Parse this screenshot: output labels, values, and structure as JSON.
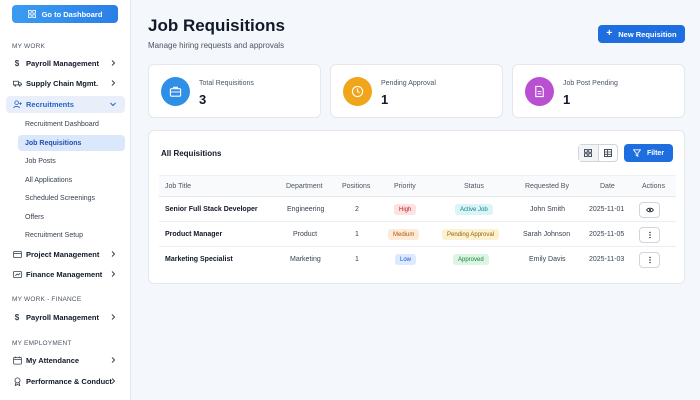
{
  "sidebar": {
    "dashboard_button": "Go to Dashboard",
    "sections": {
      "my_work": "MY WORK",
      "my_work_finance": "MY WORK - FINANCE",
      "my_employment": "MY EMPLOYMENT"
    },
    "items": {
      "payroll": {
        "label": "Payroll Management",
        "icon": "dollar-icon"
      },
      "supply_chain": {
        "label": "Supply Chain Mgmt.",
        "icon": "truck-icon"
      },
      "recruitments": {
        "label": "Recruitments",
        "icon": "user-plus-icon"
      },
      "project": {
        "label": "Project Management",
        "icon": "folder-icon"
      },
      "finance": {
        "label": "Finance Management",
        "icon": "finance-icon"
      },
      "payroll_finance": {
        "label": "Payroll Management",
        "icon": "dollar-icon"
      },
      "attendance": {
        "label": "My Attendance",
        "icon": "calendar-icon"
      },
      "performance": {
        "label": "Performance & Conduct",
        "icon": "award-icon"
      }
    },
    "recruitment_sub": [
      "Recruitment Dashboard",
      "Job Requisitions",
      "Job Posts",
      "All Applications",
      "Scheduled Screenings",
      "Offers",
      "Recruitment Setup"
    ]
  },
  "header": {
    "title": "Job Requisitions",
    "subtitle": "Manage hiring requests and approvals",
    "new_button": "New Requisition"
  },
  "stats": [
    {
      "label": "Total Requisitions",
      "value": "3",
      "color": "#2f8fe6",
      "icon": "briefcase-icon"
    },
    {
      "label": "Pending Approval",
      "value": "1",
      "color": "#f0a51a",
      "icon": "clock-icon"
    },
    {
      "label": "Job Post Pending",
      "value": "1",
      "color": "#b94fd1",
      "icon": "document-icon"
    }
  ],
  "table": {
    "title": "All Requisitions",
    "filter_button": "Filter",
    "columns": [
      "Job Title",
      "Department",
      "Positions",
      "Priority",
      "Status",
      "Requested By",
      "Date",
      "Actions"
    ],
    "rows": [
      {
        "title": "Senior Full Stack Developer",
        "department": "Engineering",
        "positions": "2",
        "priority": "High",
        "status": "Active Job",
        "requested_by": "John Smith",
        "date": "2025-11-01",
        "action": "eye-icon"
      },
      {
        "title": "Product Manager",
        "department": "Product",
        "positions": "1",
        "priority": "Medium",
        "status": "Pending Approval",
        "requested_by": "Sarah Johnson",
        "date": "2025-11-05",
        "action": "more-vertical-icon"
      },
      {
        "title": "Marketing Specialist",
        "department": "Marketing",
        "positions": "1",
        "priority": "Low",
        "status": "Approved",
        "requested_by": "Emily Davis",
        "date": "2025-11-03",
        "action": "more-vertical-icon"
      }
    ]
  },
  "colors": {
    "accent": "#1f6ee0",
    "priority_high": "#fde2e2",
    "priority_medium": "#fdebd7",
    "priority_low": "#dbeafe",
    "status_active": "#d9f5f7",
    "status_pending": "#fdf1cf",
    "status_approved": "#dcf5e3"
  }
}
